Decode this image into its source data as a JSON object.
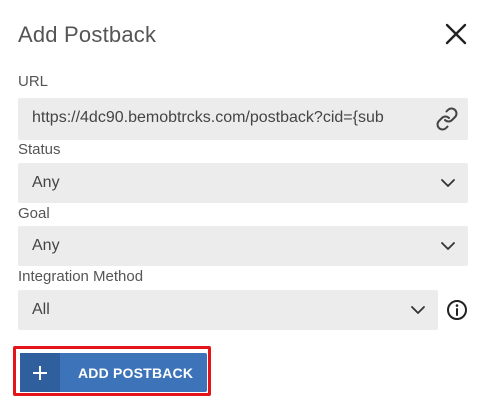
{
  "dialog": {
    "title": "Add Postback",
    "close_icon": "close-icon"
  },
  "url": {
    "label": "URL",
    "value": "https://4dc90.bemobtrcks.com/postback?cid={sub",
    "icon": "link-icon"
  },
  "status": {
    "label": "Status",
    "value": "Any",
    "icon": "chevron-down-icon"
  },
  "goal": {
    "label": "Goal",
    "value": "Any",
    "icon": "chevron-down-icon"
  },
  "integration": {
    "label": "Integration Method",
    "value": "All",
    "icon": "chevron-down-icon",
    "info_icon": "info-icon"
  },
  "actions": {
    "add_label": "ADD POSTBACK",
    "add_icon": "plus-icon",
    "button_color": "#3d74b9",
    "highlight_color": "#e4141b"
  }
}
